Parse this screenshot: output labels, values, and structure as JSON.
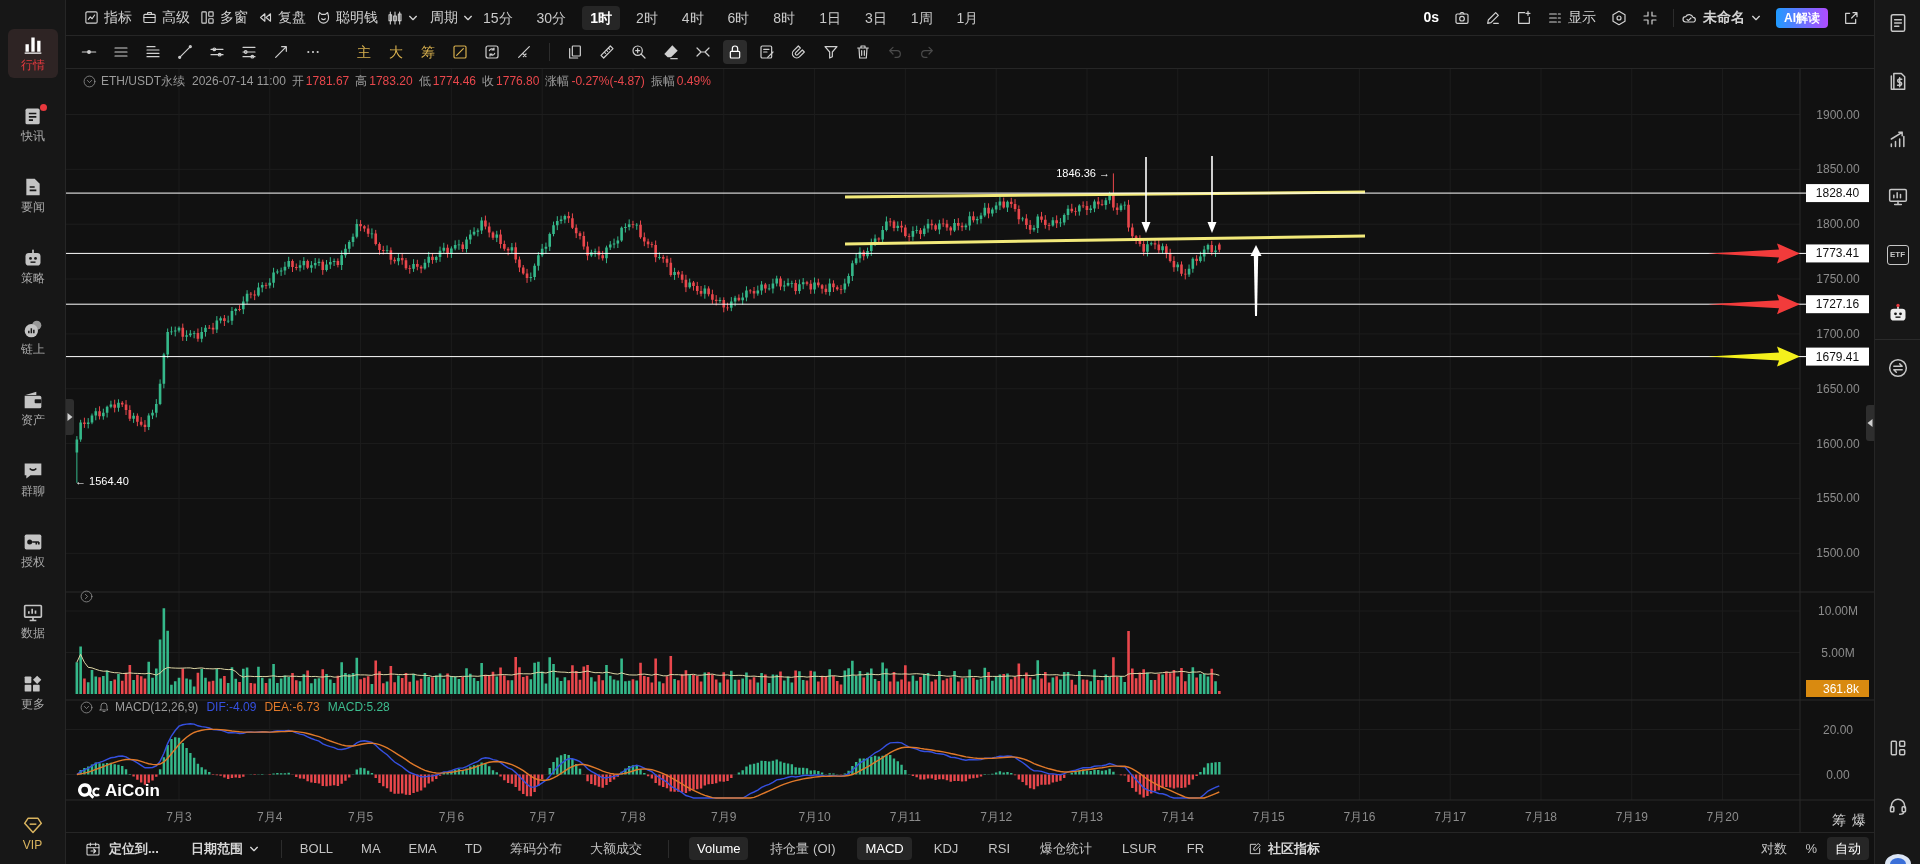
{
  "sidebar": {
    "items": [
      {
        "label": "行情",
        "selected": true,
        "unread": false
      },
      {
        "label": "快讯",
        "selected": false,
        "unread": true
      },
      {
        "label": "要闻",
        "selected": false,
        "unread": false
      },
      {
        "label": "策略",
        "selected": false,
        "unread": false
      },
      {
        "label": "链上",
        "selected": false,
        "unread": false
      },
      {
        "label": "资产",
        "selected": false,
        "unread": false
      },
      {
        "label": "群聊",
        "selected": false,
        "unread": false
      },
      {
        "label": "授权",
        "selected": false,
        "unread": false
      },
      {
        "label": "数据",
        "selected": false,
        "unread": false
      },
      {
        "label": "更多",
        "selected": false,
        "unread": false
      }
    ],
    "vip": "VIP"
  },
  "toolbar": {
    "tools": [
      "指标",
      "高级",
      "多窗",
      "复盘",
      "聪明钱"
    ],
    "period_label": "周期",
    "periods": [
      {
        "label": "15分",
        "selected": false
      },
      {
        "label": "30分",
        "selected": false
      },
      {
        "label": "1时",
        "selected": true
      },
      {
        "label": "2时",
        "selected": false
      },
      {
        "label": "4时",
        "selected": false
      },
      {
        "label": "6时",
        "selected": false
      },
      {
        "label": "8时",
        "selected": false
      },
      {
        "label": "1日",
        "selected": false
      },
      {
        "label": "3日",
        "selected": false
      },
      {
        "label": "1周",
        "selected": false
      },
      {
        "label": "1月",
        "selected": false
      }
    ],
    "countdown": "0s",
    "display": "显示",
    "layout_name": "未命名",
    "ai_button": "AI解读"
  },
  "drawing_tools": {
    "overlay_toggles": [
      "主",
      "大",
      "筹"
    ],
    "lock_on": true,
    "undo_disabled": true,
    "redo_disabled": true
  },
  "chart": {
    "symbol": "ETH/USDT永续",
    "time": "2026-07-14 11:00",
    "quote": [
      {
        "label": "开",
        "value": "1781.67"
      },
      {
        "label": "高",
        "value": "1783.20"
      },
      {
        "label": "低",
        "value": "1774.46"
      },
      {
        "label": "收",
        "value": "1776.80"
      },
      {
        "label": "涨幅",
        "value": "-0.27%(-4.87)"
      },
      {
        "label": "振幅",
        "value": "0.49%"
      }
    ],
    "price_axis": [
      "1900.00",
      "1850.00",
      "1800.00",
      "1750.00",
      "1700.00",
      "1650.00",
      "1600.00",
      "1550.00",
      "1500.00"
    ],
    "levels": [
      {
        "value": "1828.40"
      },
      {
        "value": "1773.41",
        "color": "#f23b3b"
      },
      {
        "value": "1727.16",
        "color": "#f23b3b"
      },
      {
        "value": "1679.41",
        "color": "#f4f01c"
      }
    ],
    "high_label": "1846.36 →",
    "low_label": "← 1564.40",
    "logo": "AiCoin"
  },
  "volume": {
    "axis": [
      "10.00M",
      "5.00M"
    ],
    "last": "361.8k"
  },
  "macd": {
    "title": "MACD(12,26,9)",
    "readings": [
      {
        "text": "DIF:-4.09",
        "color": "#3550e0"
      },
      {
        "text": "DEA:-6.73",
        "color": "#e0792a"
      },
      {
        "text": "MACD:5.28",
        "color": "#3dbd8f"
      }
    ],
    "axis": [
      "20.00",
      "0.00"
    ]
  },
  "date_axis": [
    "7月3",
    "7月4",
    "7月5",
    "7月6",
    "7月7",
    "7月8",
    "7月9",
    "7月10",
    "7月11",
    "7月12",
    "7月13",
    "7月14",
    "7月15",
    "7月16",
    "7月17",
    "7月18",
    "7月19",
    "7月20"
  ],
  "corner_labels": [
    "筹",
    "爆"
  ],
  "bottom_bar": {
    "locate": "定位到...",
    "date_range": "日期范围",
    "main_indicators": [
      {
        "label": "BOLL",
        "selected": false
      },
      {
        "label": "MA",
        "selected": false
      },
      {
        "label": "EMA",
        "selected": false
      },
      {
        "label": "TD",
        "selected": false
      },
      {
        "label": "筹码分布",
        "selected": false
      },
      {
        "label": "大额成交",
        "selected": false
      }
    ],
    "sub_indicators": [
      {
        "label": "Volume",
        "selected": true
      },
      {
        "label": "持仓量 (OI)",
        "selected": false
      },
      {
        "label": "MACD",
        "selected": true
      },
      {
        "label": "KDJ",
        "selected": false
      },
      {
        "label": "RSI",
        "selected": false
      },
      {
        "label": "爆仓统计",
        "selected": false
      },
      {
        "label": "LSUR",
        "selected": false
      },
      {
        "label": "FR",
        "selected": false
      }
    ],
    "community": "社区指标",
    "scale_modes": [
      {
        "label": "对数",
        "selected": false
      },
      {
        "label": "%",
        "selected": false
      },
      {
        "label": "自动",
        "selected": true
      }
    ]
  },
  "right_sidebar": {
    "etf_label": "ETF"
  }
}
